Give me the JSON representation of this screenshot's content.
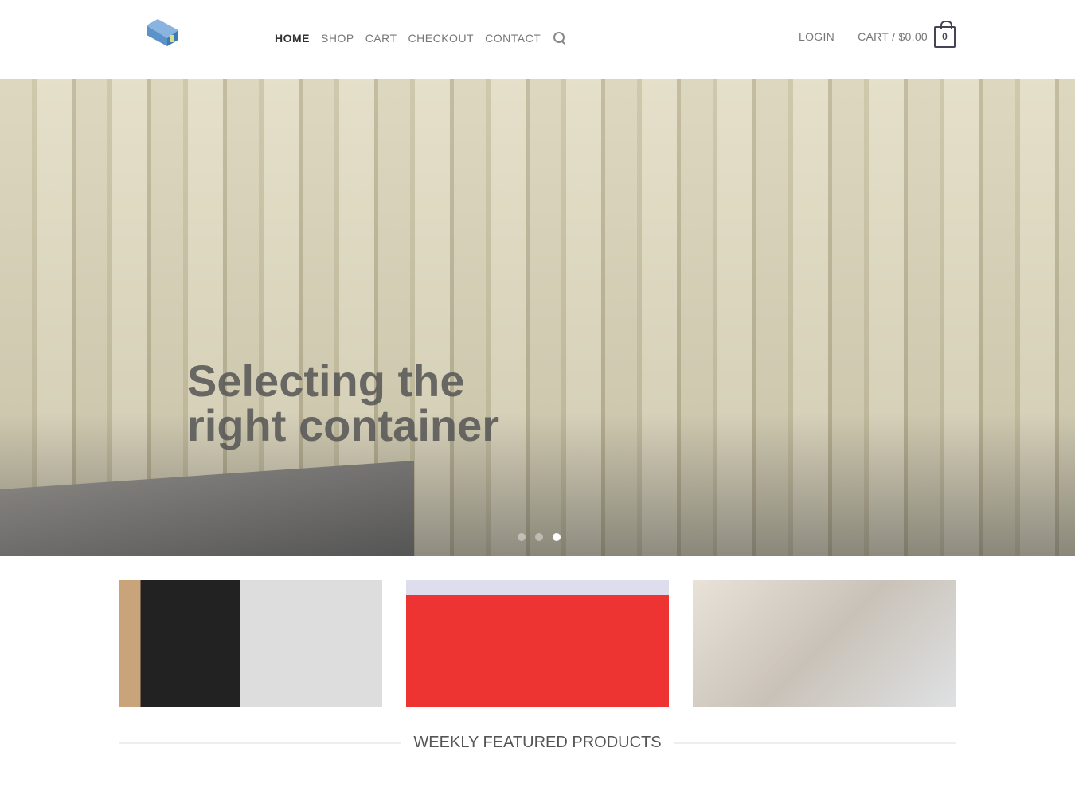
{
  "header": {
    "logo_alt": "container logo",
    "nav": [
      "HOME",
      "SHOP",
      "CART",
      "CHECKOUT",
      "CONTACT"
    ],
    "login": "LOGIN",
    "cart": "CART / $0.00",
    "cart_count": "0"
  },
  "hero": {
    "title": "Selecting the right container",
    "slides": 3,
    "active_slide": 3
  },
  "section": {
    "title": "WEEKLY FEATURED PRODUCTS"
  },
  "colors": {
    "accent": "#445566",
    "text": "#777777"
  }
}
